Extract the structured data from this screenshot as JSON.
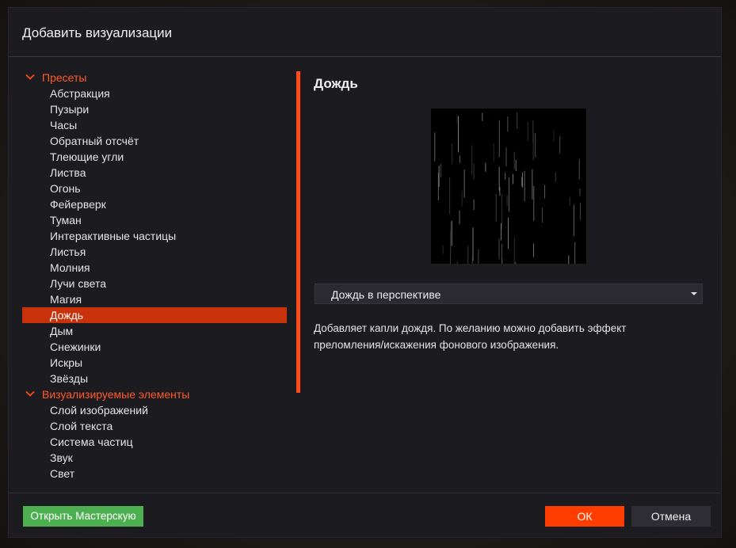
{
  "dialog": {
    "title": "Добавить визуализации"
  },
  "tree": {
    "groups": [
      {
        "label": "Пресеты",
        "items": [
          "Абстракция",
          "Пузыри",
          "Часы",
          "Обратный отсчёт",
          "Тлеющие угли",
          "Листва",
          "Огонь",
          "Фейерверк",
          "Туман",
          "Интерактивные частицы",
          "Листья",
          "Молния",
          "Лучи света",
          "Магия",
          "Дождь",
          "Дым",
          "Снежинки",
          "Искры",
          "Звёзды"
        ]
      },
      {
        "label": "Визуализируемые элементы",
        "items": [
          "Слой изображений",
          "Слой текста",
          "Система частиц",
          "Звук",
          "Свет"
        ]
      }
    ],
    "selected": "Дождь"
  },
  "detail": {
    "title": "Дождь",
    "variant": "Дождь в перспективе",
    "description": "Добавляет капли дождя. По желанию можно добавить эффект преломления/искажения фонового изображения."
  },
  "buttons": {
    "workshop": "Открыть Мастерскую",
    "ok": "ОК",
    "cancel": "Отмена"
  },
  "colors": {
    "accent": "#ff4a1c",
    "selection": "#c8320b",
    "workshop_green": "#4caf50",
    "ok_orange": "#ff3d00"
  },
  "icons": {
    "group_toggle": "chevron-down-icon",
    "select_arrow": "caret-down-icon"
  }
}
